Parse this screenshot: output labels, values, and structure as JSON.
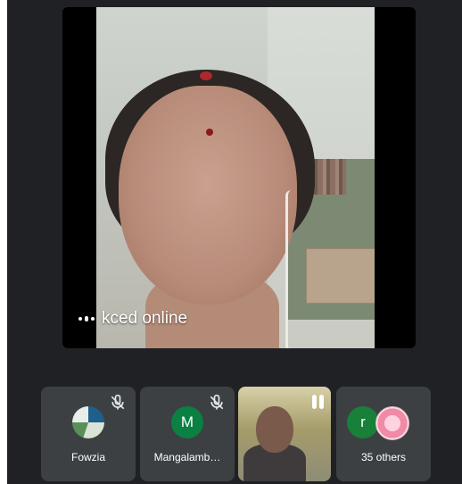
{
  "main_tile": {
    "participant_name": "kced online",
    "audio_indicator_icon": "audio-level-icon"
  },
  "filmstrip": [
    {
      "name": "Fowzia",
      "muted": true,
      "avatar": "photo"
    },
    {
      "name": "Mangalamb…",
      "muted": true,
      "avatar_letter": "M",
      "avatar_color": "#0b8043"
    },
    {
      "name": "",
      "video": true,
      "speaking_icon": "audio-level-icon"
    },
    {
      "name": "35 others",
      "avatar_letter": "r",
      "avatar_color": "#188038"
    }
  ],
  "icons": {
    "mute": "mic-off-icon",
    "speaking": "audio-level-icon"
  }
}
